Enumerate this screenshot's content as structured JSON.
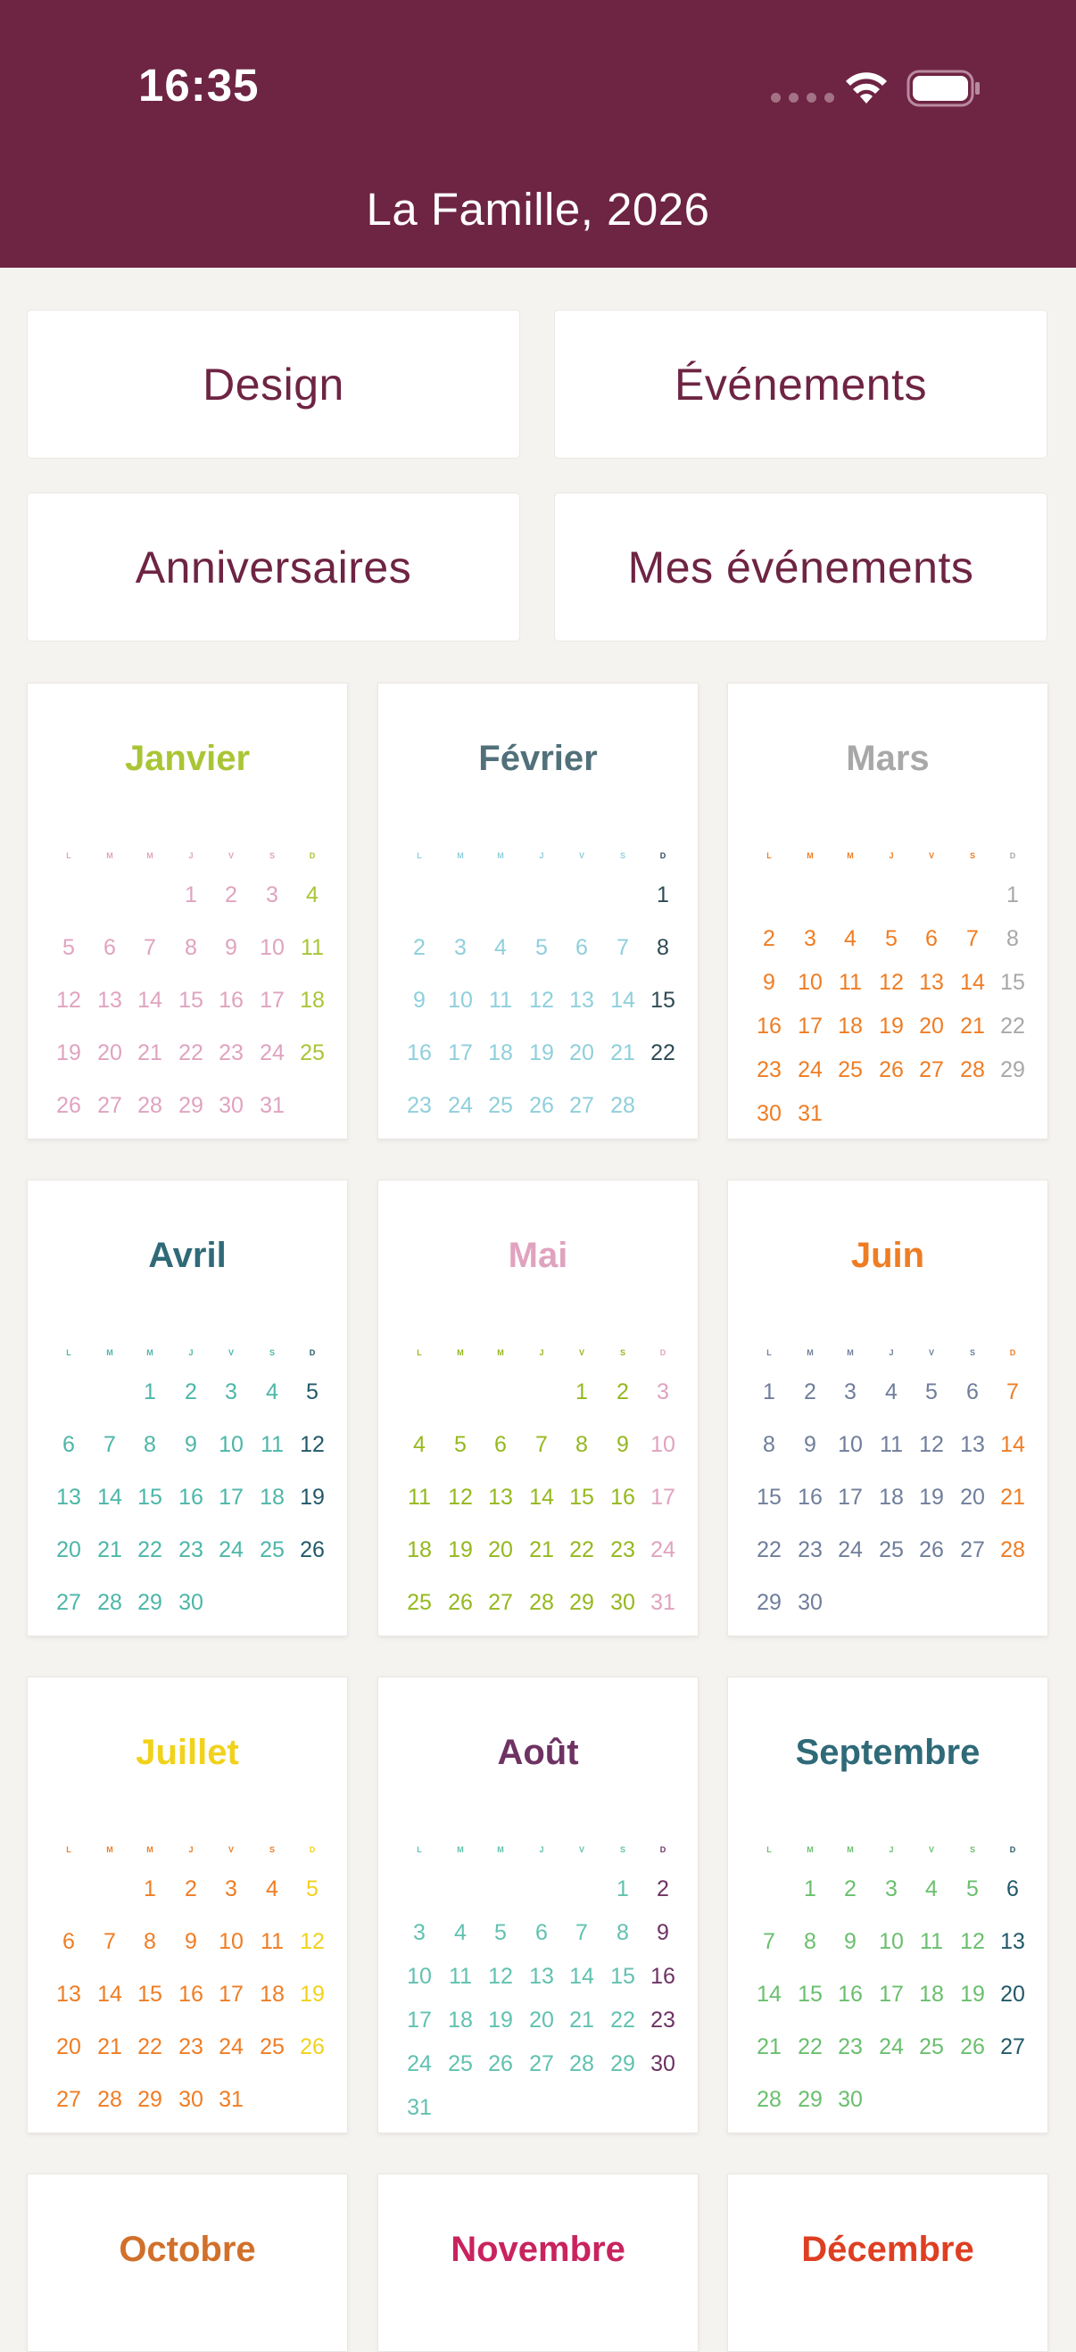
{
  "status": {
    "time": "16:35"
  },
  "header": {
    "title": "La Famille, 2026"
  },
  "menu": [
    {
      "label": "Design"
    },
    {
      "label": "Événements"
    },
    {
      "label": "Anniversaires"
    },
    {
      "label": "Mes événements"
    }
  ],
  "weekday_letters": [
    "L",
    "M",
    "M",
    "J",
    "V",
    "S",
    "D"
  ],
  "colors": {
    "header_bg": "#6e2443",
    "menu_text": "#6e2443",
    "page_bg": "#f5f3f0"
  },
  "months": [
    {
      "name": "Janvier",
      "title_color": "#a9c536",
      "color": "#e0a3bf",
      "sunday_color": "#a9c536",
      "saturday_color": "#e0a3bf",
      "weekday_color": "#e0a3bf",
      "offset": 3,
      "days": 31,
      "rows": 5
    },
    {
      "name": "Février",
      "title_color": "#51707a",
      "color": "#8fcfdc",
      "sunday_color": "#2e4b55",
      "saturday_color": "#8fcfdc",
      "weekday_color": "#8fcfdc",
      "offset": 6,
      "days": 28,
      "rows": 5
    },
    {
      "name": "Mars",
      "title_color": "#a8a8a8",
      "color": "#ef7d24",
      "sunday_color": "#a8a8a8",
      "saturday_color": "#ef7d24",
      "weekday_color": "#ef7d24",
      "offset": 6,
      "days": 31,
      "rows": 6
    },
    {
      "name": "Avril",
      "title_color": "#2f6a78",
      "color": "#4db6a8",
      "sunday_color": "#22596a",
      "saturday_color": "#4db6a8",
      "weekday_color": "#4db6a8",
      "offset": 2,
      "days": 30,
      "rows": 5
    },
    {
      "name": "Mai",
      "title_color": "#e0a3bf",
      "color": "#95b81e",
      "sunday_color": "#e0a3bf",
      "saturday_color": "#95b81e",
      "weekday_color": "#95b81e",
      "offset": 4,
      "days": 31,
      "rows": 5
    },
    {
      "name": "Juin",
      "title_color": "#ef7d24",
      "color": "#6f7e9b",
      "sunday_color": "#ef7d24",
      "saturday_color": "#6f7e9b",
      "weekday_color": "#6f7e9b",
      "offset": 0,
      "days": 30,
      "rows": 5
    },
    {
      "name": "Juillet",
      "title_color": "#f1d21b",
      "color": "#ef7d24",
      "sunday_color": "#f1d21b",
      "saturday_color": "#ef7d24",
      "weekday_color": "#ef7d24",
      "offset": 2,
      "days": 31,
      "rows": 5
    },
    {
      "name": "Août",
      "title_color": "#6e3263",
      "color": "#62c1b0",
      "sunday_color": "#6e3263",
      "saturday_color": "#62c1b0",
      "weekday_color": "#62c1b0",
      "offset": 5,
      "days": 31,
      "rows": 6
    },
    {
      "name": "Septembre",
      "title_color": "#2f6a78",
      "color": "#6abf6e",
      "sunday_color": "#22596a",
      "saturday_color": "#6abf6e",
      "weekday_color": "#6abf6e",
      "offset": 1,
      "days": 30,
      "rows": 5
    },
    {
      "name": "Octobre",
      "title_color": "#d1702a"
    },
    {
      "name": "Novembre",
      "title_color": "#c8235f"
    },
    {
      "name": "Décembre",
      "title_color": "#de3f22"
    }
  ]
}
